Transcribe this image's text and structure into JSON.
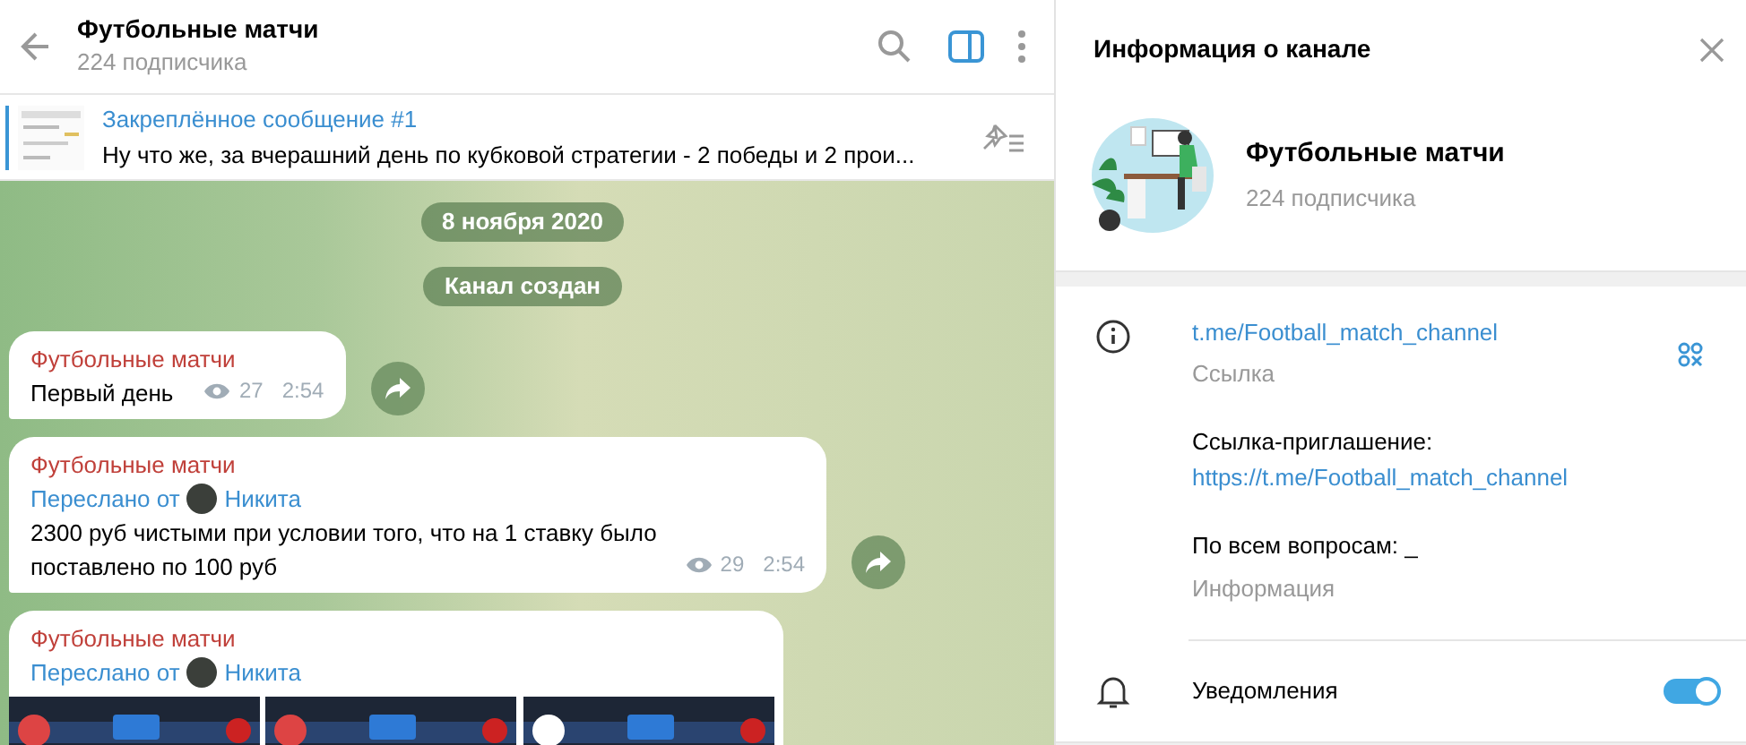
{
  "header": {
    "title": "Футбольные матчи",
    "subtitle": "224 подписчика",
    "info_panel_active": true
  },
  "pinned": {
    "title": "Закреплённое сообщение #1",
    "text": "Ну что же, за вчерашний день по кубковой стратегии - 2 победы и 2 прои..."
  },
  "service_messages": [
    "8 ноября 2020",
    "Канал создан"
  ],
  "messages": [
    {
      "author": "Футбольные матчи",
      "text": "Первый день",
      "views": "27",
      "time": "2:54",
      "share_button": true
    },
    {
      "author": "Футбольные матчи",
      "forwarded_from": {
        "label": "Переслано от",
        "name": "Никита"
      },
      "text": "2300 руб чистыми при условии того, что на 1 ставку было поставлено по 100 руб",
      "views": "29",
      "time": "2:54",
      "share_button": true
    },
    {
      "author": "Футбольные матчи",
      "forwarded_from": {
        "label": "Переслано от",
        "name": "Никита"
      },
      "share_button": false
    }
  ],
  "info_panel": {
    "title": "Информация о канале",
    "channel": {
      "name": "Футбольные матчи",
      "subscribers": "224 подписчика"
    },
    "rows": [
      {
        "kind": "link",
        "value": "t.me/Football_match_channel",
        "label": "Ссылка"
      },
      {
        "kind": "invite",
        "label": "Ссылка-приглашение:",
        "value": "https://t.me/Football_match_channel"
      },
      {
        "kind": "about",
        "value": "По всем вопросам: _",
        "label": "Информация"
      }
    ],
    "notifications": {
      "label": "Уведомления",
      "on": true
    }
  }
}
